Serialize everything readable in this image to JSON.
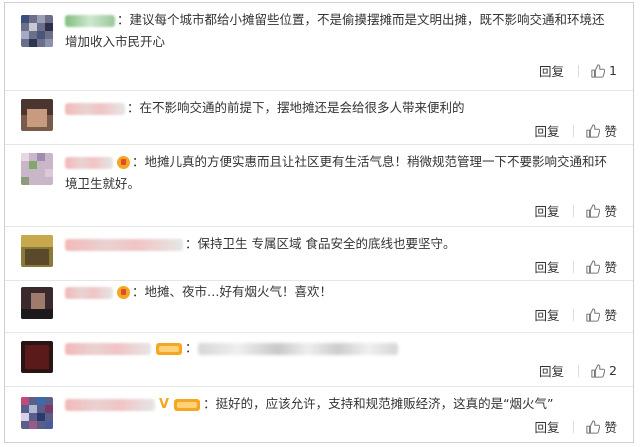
{
  "comments": [
    {
      "text": "：建议每个城市都给小摊留些位置，不是偷摸摆摊而是文明出摊，既不影响交通和环境还增加收入市民开心",
      "reply": "回复",
      "like": "1"
    },
    {
      "text": "：在不影响交通的前提下，摆地摊还是会给很多人带来便利的",
      "reply": "回复",
      "like": "赞"
    },
    {
      "text": "：地摊儿真的方便实惠而且让社区更有生活气息！稍微规范管理一下不要影响交通和环境卫生就好。",
      "reply": "回复",
      "like": "赞"
    },
    {
      "text": "：保持卫生 专属区域 食品安全的底线也要坚守。",
      "reply": "回复",
      "like": "赞"
    },
    {
      "text": "：地摊、夜市…好有烟火气！喜欢！",
      "reply": "回复",
      "like": "赞"
    },
    {
      "text": "：",
      "reply": "回复",
      "like": "2"
    },
    {
      "text": "：挺好的，应该允许，支持和规范摊贩经济，这真的是“烟火气”",
      "reply": "回复",
      "like": "赞"
    }
  ]
}
